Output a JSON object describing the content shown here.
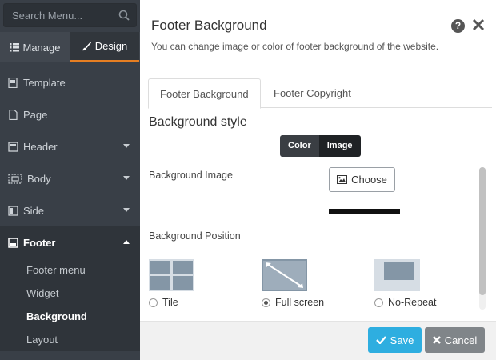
{
  "sidebar": {
    "search_placeholder": "Search Menu...",
    "tabs": [
      {
        "label": "Manage",
        "icon": "list-icon"
      },
      {
        "label": "Design",
        "icon": "brush-icon",
        "active": true
      }
    ],
    "items": [
      {
        "label": "Template",
        "icon": "template-icon"
      },
      {
        "label": "Page",
        "icon": "page-icon"
      },
      {
        "label": "Header",
        "icon": "header-icon"
      },
      {
        "label": "Body",
        "icon": "body-icon"
      },
      {
        "label": "Side",
        "icon": "side-icon"
      },
      {
        "label": "Footer",
        "icon": "footer-icon",
        "open": true
      }
    ],
    "sub_items": [
      {
        "label": "Footer menu"
      },
      {
        "label": "Widget"
      },
      {
        "label": "Background",
        "active": true
      },
      {
        "label": "Layout"
      }
    ]
  },
  "panel": {
    "title": "Footer Background",
    "subtitle": "You can change image or color of footer background of the website.",
    "help_icon": "?",
    "tabs": [
      "Footer Background",
      "Footer Copyright"
    ],
    "section_title": "Background style",
    "toggle": {
      "color": "Color",
      "image": "Image",
      "selected": "Image"
    },
    "bg_image_label": "Background Image",
    "choose_label": "Choose",
    "bg_position_label": "Background Position",
    "positions": [
      {
        "label": "Tile",
        "checked": false
      },
      {
        "label": "Full screen",
        "checked": true
      },
      {
        "label": "No-Repeat",
        "checked": false
      }
    ],
    "save_label": "Save",
    "cancel_label": "Cancel"
  },
  "colors": {
    "sidebar_bg": "#393f47",
    "accent": "#e67e22",
    "save": "#2eaee0",
    "cancel": "#808589"
  }
}
